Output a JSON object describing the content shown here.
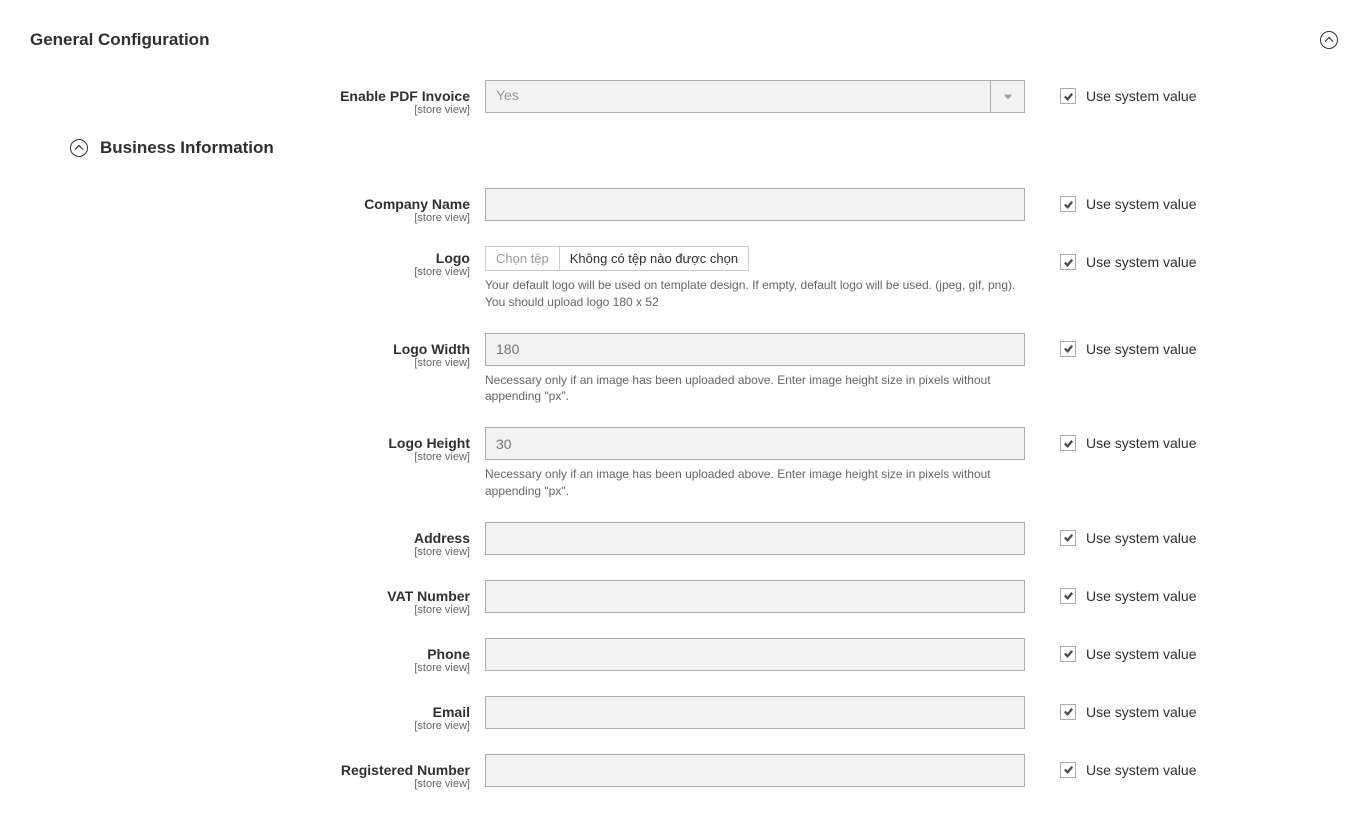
{
  "section": {
    "title": "General Configuration"
  },
  "subsection": {
    "title": "Business Information"
  },
  "scope_label": "[store view]",
  "use_system_label": "Use system value",
  "fields": {
    "enable_pdf": {
      "label": "Enable PDF Invoice",
      "value": "Yes"
    },
    "company_name": {
      "label": "Company Name",
      "value": ""
    },
    "logo": {
      "label": "Logo",
      "file_btn": "Chọn tệp",
      "file_status": "Không có tệp nào được chọn",
      "help": "Your default logo will be used on template design. If empty, default logo will be used. (jpeg, gif, png). You should upload logo 180 x 52"
    },
    "logo_width": {
      "label": "Logo Width",
      "placeholder": "180",
      "help": "Necessary only if an image has been uploaded above. Enter image height size in pixels without appending \"px\"."
    },
    "logo_height": {
      "label": "Logo Height",
      "placeholder": "30",
      "help": "Necessary only if an image has been uploaded above. Enter image height size in pixels without appending \"px\"."
    },
    "address": {
      "label": "Address",
      "value": ""
    },
    "vat_number": {
      "label": "VAT Number",
      "value": ""
    },
    "phone": {
      "label": "Phone",
      "value": ""
    },
    "email": {
      "label": "Email",
      "value": ""
    },
    "registered_number": {
      "label": "Registered Number",
      "value": ""
    }
  }
}
